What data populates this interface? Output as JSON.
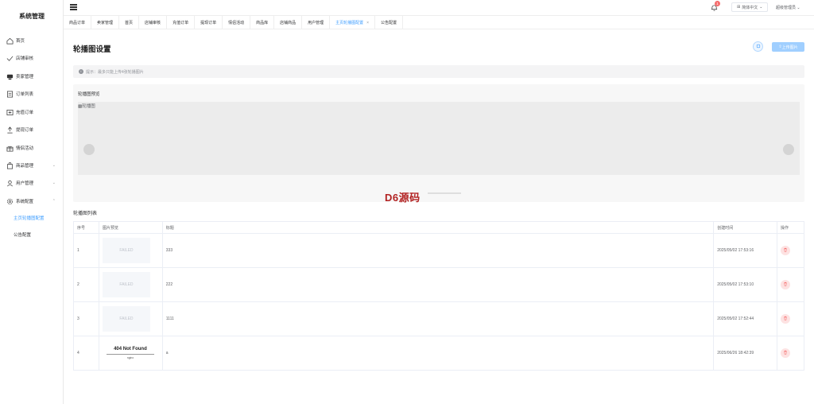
{
  "app": {
    "title": "系统管理"
  },
  "sidebar": {
    "items": [
      {
        "label": "首页",
        "icon": "home-icon"
      },
      {
        "label": "店铺审核",
        "icon": "check-icon"
      },
      {
        "label": "卖家管理",
        "icon": "seller-icon"
      },
      {
        "label": "订单列表",
        "icon": "document-icon"
      },
      {
        "label": "充值订单",
        "icon": "recharge-icon"
      },
      {
        "label": "提现订单",
        "icon": "withdraw-icon"
      },
      {
        "label": "情侣活动",
        "icon": "gift-icon"
      },
      {
        "label": "商品管理",
        "icon": "bag-icon",
        "expandable": true
      },
      {
        "label": "用户管理",
        "icon": "user-icon",
        "expandable": true
      },
      {
        "label": "系统配置",
        "icon": "gear-icon",
        "expandable": true,
        "expanded": true
      }
    ],
    "sub_items": [
      {
        "label": "主页轮播图配置",
        "active": true
      },
      {
        "label": "公告配置",
        "active": false
      }
    ]
  },
  "header": {
    "notification_count": "1",
    "language": "简体中文",
    "user": "超级管理员"
  },
  "tabs": [
    {
      "label": "商品订单"
    },
    {
      "label": "卖家管理"
    },
    {
      "label": "首页"
    },
    {
      "label": "店铺审核"
    },
    {
      "label": "充值订单"
    },
    {
      "label": "提现订单"
    },
    {
      "label": "情侣活动"
    },
    {
      "label": "商品库"
    },
    {
      "label": "店铺商品"
    },
    {
      "label": "用户管理"
    },
    {
      "label": "主页轮播图配置",
      "active": true,
      "closable": true
    },
    {
      "label": "公告配置"
    }
  ],
  "page": {
    "title": "轮播图设置",
    "upload_label": "上传图片",
    "tip": "提示：最多只能上传4张轮播图片",
    "preview_label": "轮播图预览",
    "broken_image_alt": "轮播图",
    "list_title": "轮播图列表",
    "watermark": "D6源码"
  },
  "table": {
    "headers": [
      "序号",
      "图片预览",
      "标题",
      "创建时间",
      "操作"
    ],
    "rows": [
      {
        "index": "1",
        "image": "FAILED",
        "title": "333",
        "created": "2025/05/02 17:53:16"
      },
      {
        "index": "2",
        "image": "FAILED",
        "title": "222",
        "created": "2025/05/02 17:53:10"
      },
      {
        "index": "3",
        "image": "FAILED",
        "title": "1111",
        "created": "2025/05/02 17:52:44"
      },
      {
        "index": "4",
        "image_404_title": "404 Not Found",
        "image_404_sub": "nginx",
        "title": "a",
        "created": "2025/06/26 18:42:39"
      }
    ]
  },
  "colors": {
    "accent": "#409eff",
    "danger": "#f56c6c",
    "watermark": "#b22222"
  }
}
